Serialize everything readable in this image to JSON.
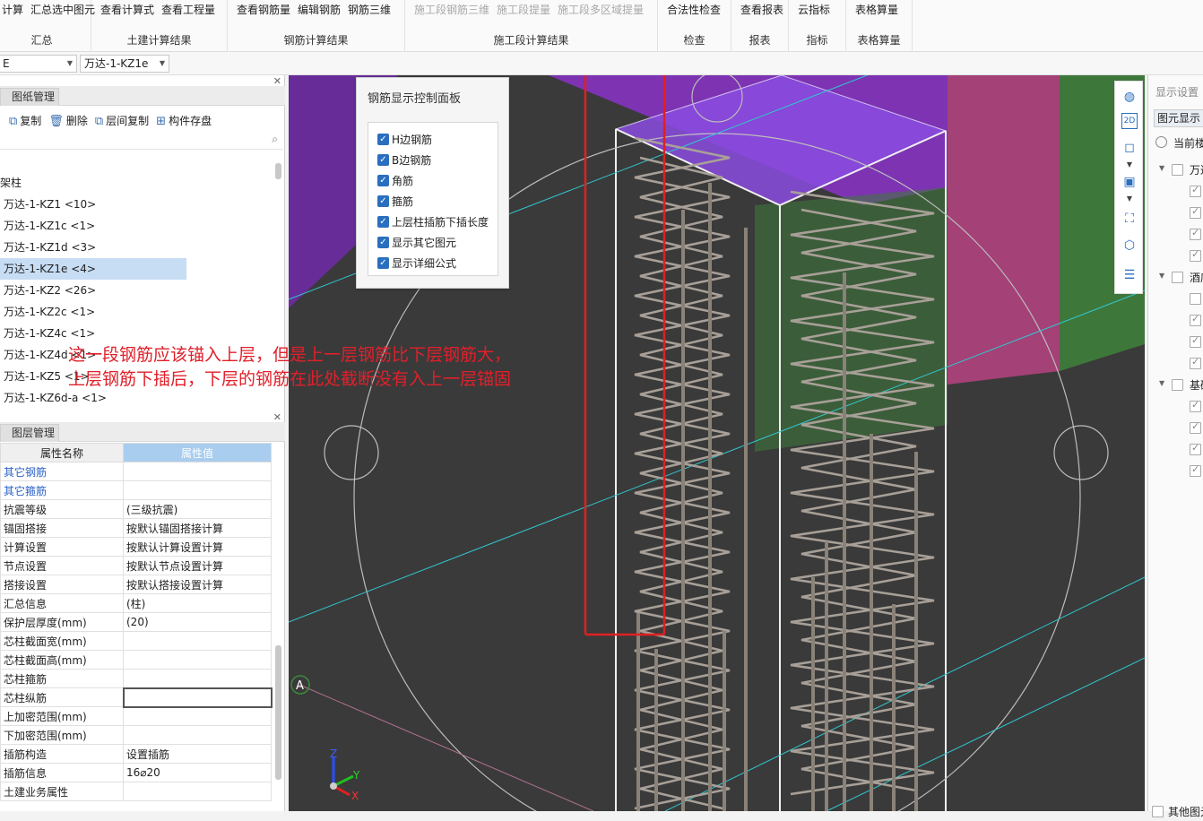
{
  "ribbon": {
    "groups": [
      {
        "buttons": [
          {
            "label": "计算",
            "disabled": false
          },
          {
            "label": "汇总选中图元",
            "disabled": false
          }
        ],
        "label": "汇总"
      },
      {
        "buttons": [
          {
            "label": "查看计算式",
            "disabled": false
          },
          {
            "label": "查看工程量",
            "disabled": false
          }
        ],
        "label": "土建计算结果"
      },
      {
        "buttons": [
          {
            "label": "查看钢筋量",
            "disabled": false
          },
          {
            "label": "编辑钢筋",
            "disabled": false
          },
          {
            "label": "钢筋三维",
            "disabled": false
          }
        ],
        "label": "钢筋计算结果"
      },
      {
        "buttons": [
          {
            "label": "施工段钢筋三维",
            "disabled": true
          },
          {
            "label": "施工段提量",
            "disabled": true
          },
          {
            "label": "施工段多区域提量",
            "disabled": true
          }
        ],
        "label": "施工段计算结果"
      },
      {
        "buttons": [
          {
            "label": "合法性检查",
            "disabled": false
          }
        ],
        "label": "检查"
      },
      {
        "buttons": [
          {
            "label": "查看报表",
            "disabled": false
          }
        ],
        "label": "报表"
      },
      {
        "buttons": [
          {
            "label": "云指标",
            "disabled": false
          }
        ],
        "label": "指标"
      },
      {
        "buttons": [
          {
            "label": "表格算量",
            "disabled": false
          }
        ],
        "label": "表格算量"
      }
    ]
  },
  "toolbar2": {
    "dropdown1": "E",
    "dropdown2": "万达-1-KZ1e"
  },
  "drawing_panel": {
    "tab": "图纸管理",
    "tools": [
      {
        "icon": "copy-icon",
        "glyph": "⧉",
        "label": "复制"
      },
      {
        "icon": "delete-icon",
        "glyph": "🗑",
        "label": "删除"
      },
      {
        "icon": "floor-copy-icon",
        "glyph": "⧉",
        "label": "层间复制"
      },
      {
        "icon": "save-component-icon",
        "glyph": "⊞",
        "label": "构件存盘"
      }
    ],
    "tree_root": "架柱",
    "items": [
      {
        "label": "万达-1-KZ1 <10>",
        "selected": false
      },
      {
        "label": "万达-1-KZ1c <1>",
        "selected": false
      },
      {
        "label": "万达-1-KZ1d <3>",
        "selected": false
      },
      {
        "label": "万达-1-KZ1e <4>",
        "selected": true
      },
      {
        "label": "万达-1-KZ2 <26>",
        "selected": false
      },
      {
        "label": "万达-1-KZ2c <1>",
        "selected": false
      },
      {
        "label": "万达-1-KZ4c <1>",
        "selected": false
      },
      {
        "label": "万达-1-KZ4d <1>",
        "selected": false
      },
      {
        "label": "万达-1-KZ5 <1>",
        "selected": false
      },
      {
        "label": "万达-1-KZ6d-a <1>",
        "selected": false
      }
    ]
  },
  "layer_panel": {
    "tab": "图层管理",
    "headers": {
      "name": "属性名称",
      "value": "属性值"
    },
    "rows": [
      {
        "name": "其它钢筋",
        "value": "",
        "link": true
      },
      {
        "name": "其它箍筋",
        "value": "",
        "link": true
      },
      {
        "name": "抗震等级",
        "value": "(三级抗震)",
        "link": false
      },
      {
        "name": "锚固搭接",
        "value": "按默认锚固搭接计算",
        "link": false
      },
      {
        "name": "计算设置",
        "value": "按默认计算设置计算",
        "link": false
      },
      {
        "name": "节点设置",
        "value": "按默认节点设置计算",
        "link": false
      },
      {
        "name": "搭接设置",
        "value": "按默认搭接设置计算",
        "link": false
      },
      {
        "name": "汇总信息",
        "value": "(柱)",
        "link": false
      },
      {
        "name": "保护层厚度(mm)",
        "value": "(20)",
        "link": false
      },
      {
        "name": "芯柱截面宽(mm)",
        "value": "",
        "link": false
      },
      {
        "name": "芯柱截面高(mm)",
        "value": "",
        "link": false
      },
      {
        "name": "芯柱箍筋",
        "value": "",
        "link": false
      },
      {
        "name": "芯柱纵筋",
        "value": "",
        "link": false,
        "editing": true
      },
      {
        "name": "上加密范围(mm)",
        "value": "",
        "link": false
      },
      {
        "name": "下加密范围(mm)",
        "value": "",
        "link": false
      },
      {
        "name": "插筋构造",
        "value": "设置插筋",
        "link": false
      },
      {
        "name": "插筋信息",
        "value": "16⌀20",
        "link": false
      },
      {
        "name": "土建业务属性",
        "value": "",
        "link": false
      }
    ]
  },
  "control_panel": {
    "title": "钢筋显示控制面板",
    "options": [
      {
        "label": "H边钢筋",
        "checked": true
      },
      {
        "label": "B边钢筋",
        "checked": true
      },
      {
        "label": "角筋",
        "checked": true
      },
      {
        "label": "箍筋",
        "checked": true
      },
      {
        "label": "上层柱插筋下插长度",
        "checked": true
      },
      {
        "label": "显示其它图元",
        "checked": true
      },
      {
        "label": "显示详细公式",
        "checked": true
      }
    ]
  },
  "annotation": {
    "line1": "这一段钢筋应该锚入上层，但是上一层钢筋比下层钢筋大，",
    "line2": "上层钢筋下插后，下层的钢筋在此处截断没有入上一层锚固",
    "color": "#e0202a"
  },
  "viewport": {
    "axis_label_a": "A",
    "axes": {
      "x": "X",
      "y": "Y",
      "z": "Z"
    }
  },
  "right_panel": {
    "title": "显示设置",
    "tab": "图元显示",
    "radio_label": "当前楼",
    "groups": [
      {
        "label": "万达",
        "checked": false,
        "children": [
          true,
          true,
          true,
          true
        ]
      },
      {
        "label": "酒店",
        "checked": false,
        "children": [
          false,
          true,
          true,
          true
        ]
      },
      {
        "label": "基础",
        "checked": false,
        "children": [
          true,
          true,
          true,
          true
        ]
      }
    ],
    "footer": "其他图元"
  },
  "colors": {
    "accent": "#2a6fbf",
    "selection": "#c7ddf4",
    "header_blue": "#a8cdee",
    "purple": "#7a2eb0",
    "magenta": "#a83a7a",
    "green": "#3e7a3a"
  }
}
